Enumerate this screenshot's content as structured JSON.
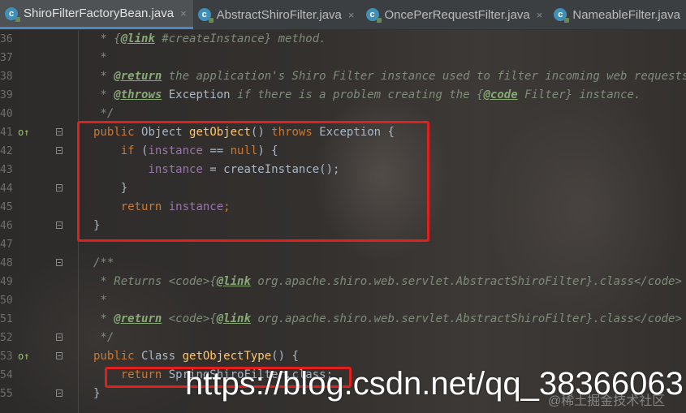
{
  "tabs": [
    {
      "label": "ShiroFilterFactoryBean.java",
      "icon": "java-class-icon",
      "active": true
    },
    {
      "label": "AbstractShiroFilter.java",
      "icon": "java-class-icon",
      "active": false
    },
    {
      "label": "OncePerRequestFilter.java",
      "icon": "java-class-icon",
      "active": false
    },
    {
      "label": "NameableFilter.java",
      "icon": "java-class-icon",
      "active": false
    }
  ],
  "tab_close_glyph": "×",
  "tab_icon_glyph": "c",
  "colors": {
    "keyword": "#cc7832",
    "method": "#ffc66d",
    "field": "#9876aa",
    "comment": "#7f8c7a",
    "highlight_box": "#e0201c",
    "active_tab_underline": "#4a88c7"
  },
  "lines": [
    {
      "num": "36",
      "segs": [
        {
          "t": " * {",
          "c": "comment"
        },
        {
          "t": "@link",
          "c": "tag"
        },
        {
          "t": " #createInstance} method.",
          "c": "comment"
        }
      ]
    },
    {
      "num": "37",
      "segs": [
        {
          "t": " *",
          "c": "comment"
        }
      ]
    },
    {
      "num": "38",
      "segs": [
        {
          "t": " * ",
          "c": "comment"
        },
        {
          "t": "@return",
          "c": "tag"
        },
        {
          "t": " the application's Shiro Filter instance used to filter incoming web requests.",
          "c": "comment"
        }
      ]
    },
    {
      "num": "39",
      "segs": [
        {
          "t": " * ",
          "c": "comment"
        },
        {
          "t": "@throws",
          "c": "tag"
        },
        {
          "t": " Exception",
          "c": "plain"
        },
        {
          "t": " if there is a problem creating the {",
          "c": "comment"
        },
        {
          "t": "@code",
          "c": "tag"
        },
        {
          "t": " Filter} instance.",
          "c": "comment"
        }
      ]
    },
    {
      "num": "40",
      "segs": [
        {
          "t": " */",
          "c": "comment"
        }
      ]
    },
    {
      "num": "41",
      "marker": "o↑",
      "fold": true,
      "segs": [
        {
          "t": "public ",
          "c": "kw"
        },
        {
          "t": "Object ",
          "c": "plain"
        },
        {
          "t": "getObject",
          "c": "fn"
        },
        {
          "t": "() ",
          "c": "plain"
        },
        {
          "t": "throws ",
          "c": "kw"
        },
        {
          "t": "Exception {",
          "c": "plain"
        }
      ]
    },
    {
      "num": "42",
      "fold": true,
      "segs": [
        {
          "t": "    ",
          "c": "plain"
        },
        {
          "t": "if ",
          "c": "kw"
        },
        {
          "t": "(",
          "c": "plain"
        },
        {
          "t": "instance",
          "c": "field"
        },
        {
          "t": " == ",
          "c": "plain"
        },
        {
          "t": "null",
          "c": "kw"
        },
        {
          "t": ") {",
          "c": "plain"
        }
      ]
    },
    {
      "num": "43",
      "segs": [
        {
          "t": "        ",
          "c": "plain"
        },
        {
          "t": "instance",
          "c": "field"
        },
        {
          "t": " = createInstance();",
          "c": "plain"
        }
      ]
    },
    {
      "num": "44",
      "fold": true,
      "segs": [
        {
          "t": "    }",
          "c": "plain"
        }
      ]
    },
    {
      "num": "45",
      "segs": [
        {
          "t": "    ",
          "c": "plain"
        },
        {
          "t": "return ",
          "c": "kw"
        },
        {
          "t": "instance",
          "c": "field"
        },
        {
          "t": ";",
          "c": "kw"
        }
      ]
    },
    {
      "num": "46",
      "fold": true,
      "segs": [
        {
          "t": "}",
          "c": "plain"
        }
      ]
    },
    {
      "num": "47",
      "segs": []
    },
    {
      "num": "48",
      "fold": true,
      "segs": [
        {
          "t": "/**",
          "c": "comment"
        }
      ]
    },
    {
      "num": "49",
      "segs": [
        {
          "t": " * Returns <code>{",
          "c": "comment"
        },
        {
          "t": "@link",
          "c": "tag"
        },
        {
          "t": " org.apache.shiro.web.servlet.AbstractShiroFilter}.class</code>",
          "c": "comment"
        }
      ]
    },
    {
      "num": "50",
      "segs": [
        {
          "t": " *",
          "c": "comment"
        }
      ]
    },
    {
      "num": "51",
      "segs": [
        {
          "t": " * ",
          "c": "comment"
        },
        {
          "t": "@return",
          "c": "tag"
        },
        {
          "t": " <code>{",
          "c": "comment"
        },
        {
          "t": "@link",
          "c": "tag"
        },
        {
          "t": " org.apache.shiro.web.servlet.AbstractShiroFilter}.class</code>",
          "c": "comment"
        }
      ]
    },
    {
      "num": "52",
      "fold": true,
      "segs": [
        {
          "t": " */",
          "c": "comment"
        }
      ]
    },
    {
      "num": "53",
      "marker": "o↑",
      "fold": true,
      "segs": [
        {
          "t": "public ",
          "c": "kw"
        },
        {
          "t": "Class ",
          "c": "plain"
        },
        {
          "t": "getObjectType",
          "c": "fn"
        },
        {
          "t": "() {",
          "c": "plain"
        }
      ]
    },
    {
      "num": "54",
      "segs": [
        {
          "t": "    ",
          "c": "plain"
        },
        {
          "t": "return ",
          "c": "kw"
        },
        {
          "t": "SpringShiroFilter.class;",
          "c": "plain"
        }
      ]
    },
    {
      "num": "55",
      "fold": true,
      "segs": [
        {
          "t": "}",
          "c": "plain"
        }
      ]
    }
  ],
  "watermark": "https://blog.csdn.net/qq_38366063",
  "watermark_secondary": "@稀土掘金技术社区"
}
